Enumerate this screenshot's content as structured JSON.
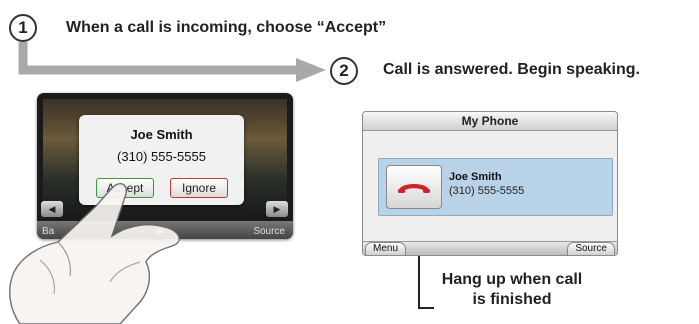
{
  "steps": [
    {
      "number": "1",
      "text": "When a call is incoming, choose “Accept”"
    },
    {
      "number": "2",
      "text": "Call is answered. Begin speaking."
    }
  ],
  "incoming_screen": {
    "caller_name": "Joe Smith",
    "caller_number": "(310) 555-5555",
    "accept_label": "Accept",
    "ignore_label": "Ignore",
    "prev_icon": "skip-back-icon",
    "next_icon": "skip-forward-icon",
    "bottom_left_label": "Ba",
    "bottom_right_label": "Source"
  },
  "phone_screen": {
    "title": "My Phone",
    "caller_name": "Joe Smith",
    "caller_number": "(310) 555-5555",
    "hangup_icon": "phone-hangup-icon",
    "menu_label": "Menu",
    "source_label": "Source"
  },
  "callout": {
    "line1": "Hang up when call",
    "line2": "is finished"
  },
  "colors": {
    "arrow": "#a9a9a9",
    "card_bg": "#b8d3e8",
    "hangup_red": "#d2232a",
    "accept_border": "#3a9a3a",
    "ignore_border": "#c0392b"
  }
}
